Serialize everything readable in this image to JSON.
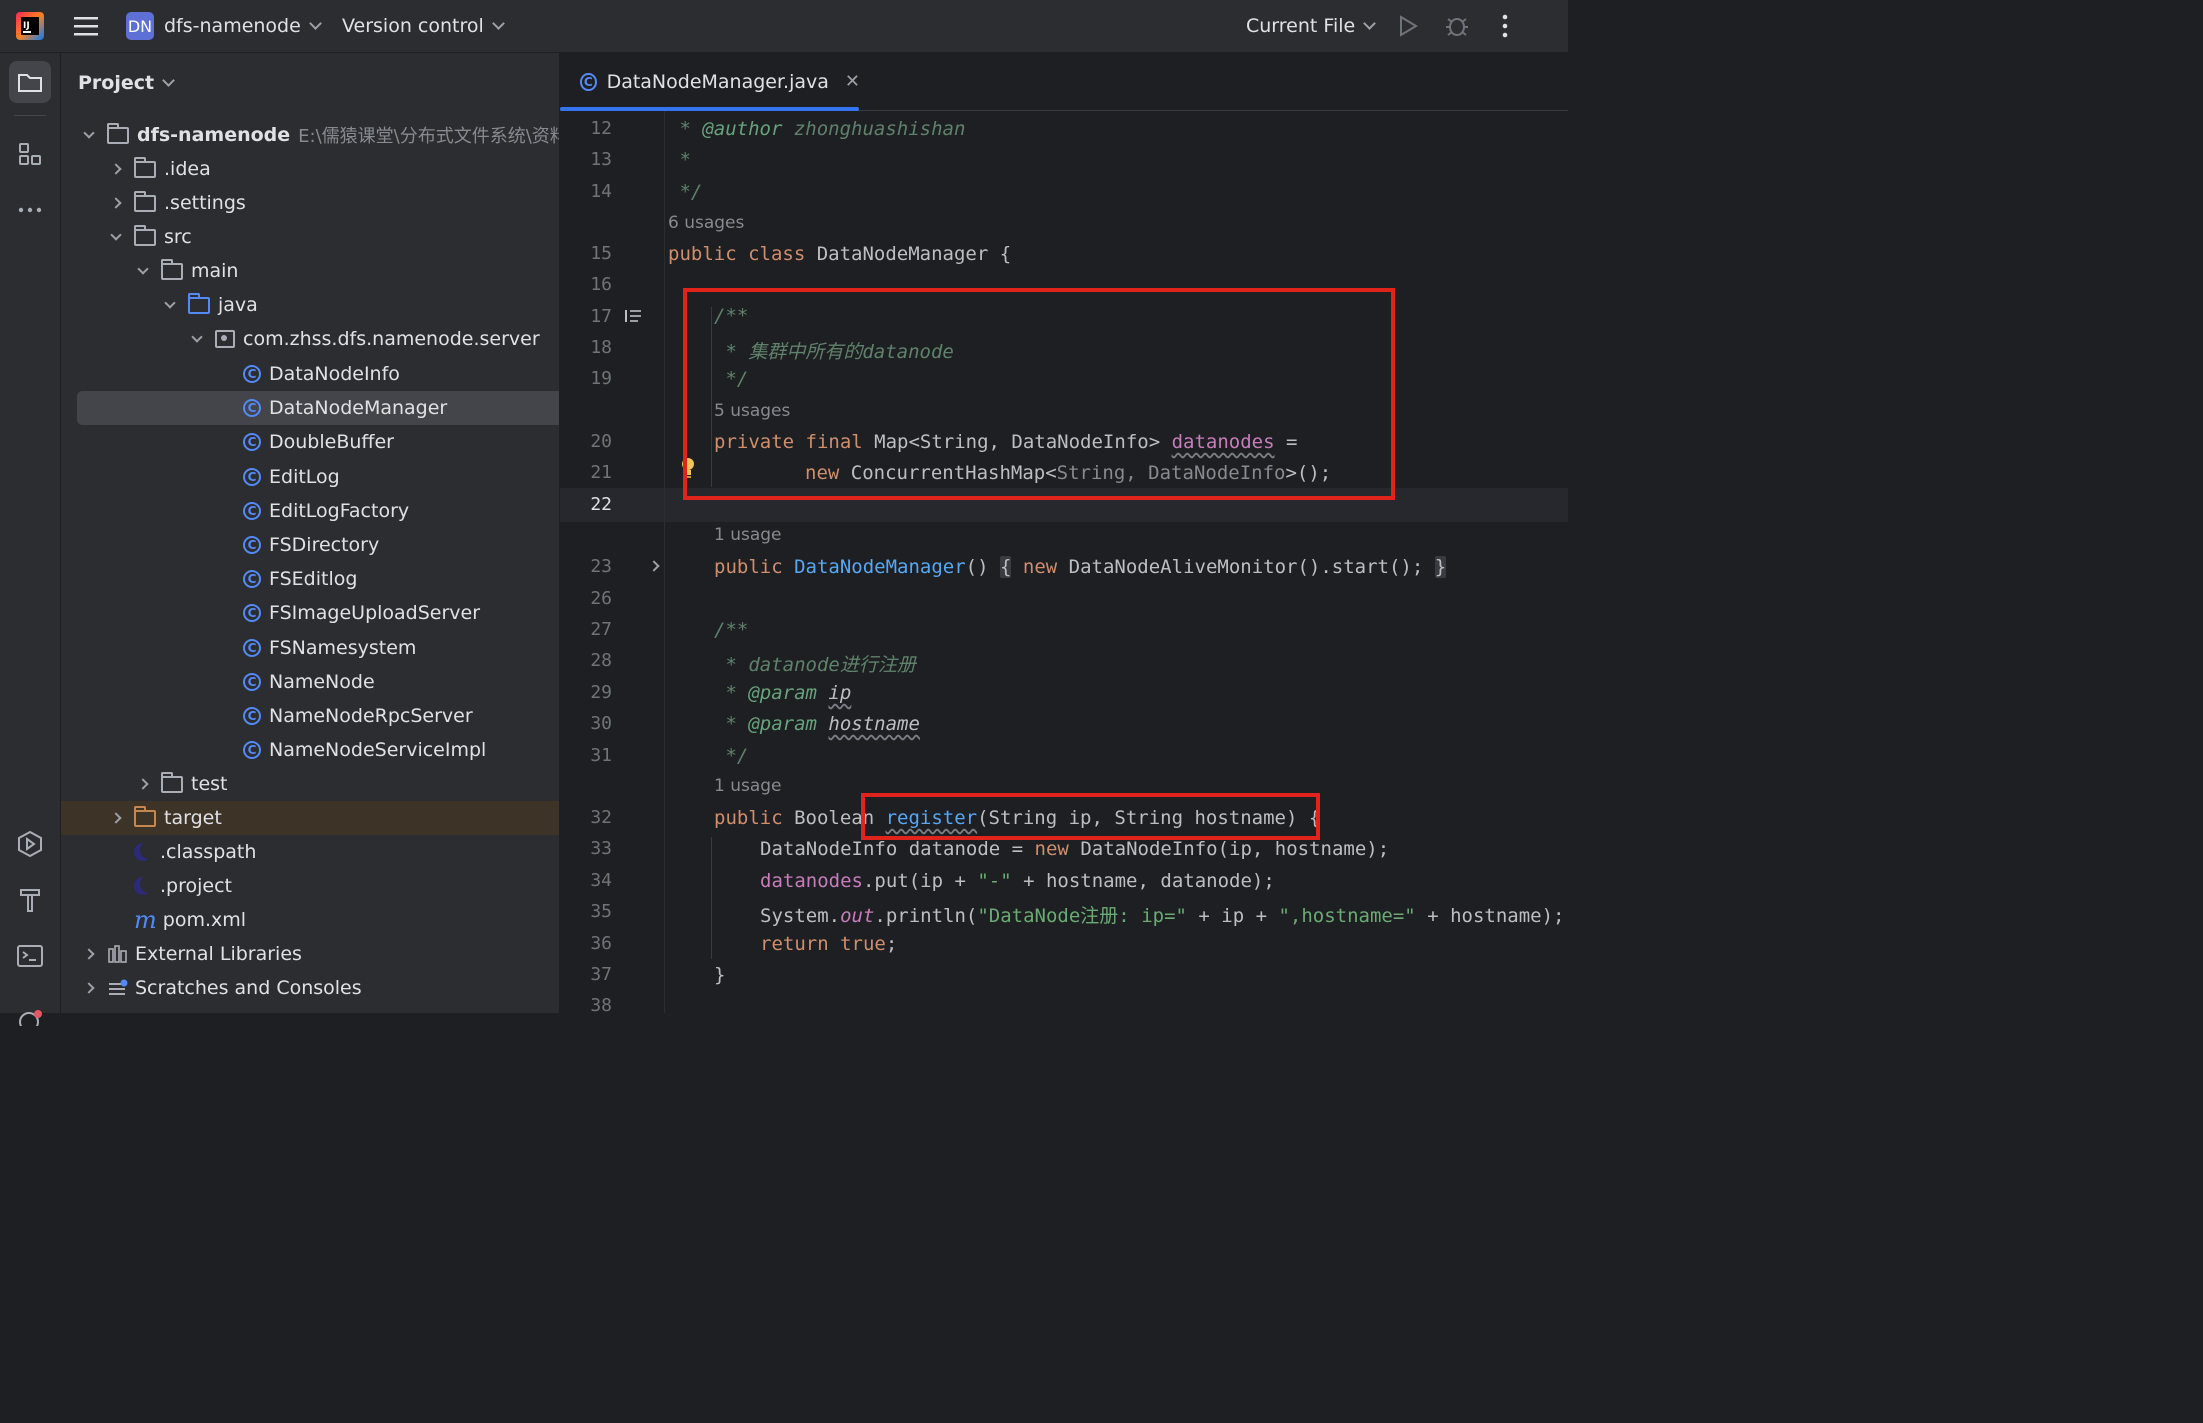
{
  "titlebar": {
    "app_logo": "intellij-logo",
    "project_badge": "DN",
    "project_name": "dfs-namenode",
    "vcs_label": "Version control",
    "run_config": "Current File"
  },
  "project_panel": {
    "title": "Project",
    "root_name": "dfs-namenode",
    "root_path": "E:\\儒猿课堂\\分布式文件系统\\资料",
    "items": {
      "idea": ".idea",
      "settings": ".settings",
      "src": "src",
      "main": "main",
      "java": "java",
      "package": "com.zhss.dfs.namenode.server",
      "classes": [
        "DataNodeInfo",
        "DataNodeManager",
        "DoubleBuffer",
        "EditLog",
        "EditLogFactory",
        "FSDirectory",
        "FSEditlog",
        "FSImageUploadServer",
        "FSNamesystem",
        "NameNode",
        "NameNodeRpcServer",
        "NameNodeServiceImpl"
      ],
      "test": "test",
      "target": "target",
      "classpath": ".classpath",
      "project_file": ".project",
      "pom": "pom.xml",
      "external_libraries": "External Libraries",
      "scratches": "Scratches and Consoles"
    }
  },
  "editor": {
    "tab_label": "DataNodeManager.java",
    "current_line": "22",
    "line_numbers": [
      "12",
      "13",
      "14",
      "15",
      "16",
      "17",
      "18",
      "19",
      "20",
      "21",
      "22",
      "23",
      "26",
      "27",
      "28",
      "29",
      "30",
      "31",
      "32",
      "33",
      "34",
      "35",
      "36",
      "37",
      "38"
    ],
    "usages": {
      "class": "6 usages",
      "field": "5 usages",
      "ctor": "1 usage",
      "register": "1 usage"
    },
    "code": {
      "author_star": " * ",
      "author_tag": "@author",
      "author_name": " zhonghuashishan",
      "star": " *",
      "end": " */",
      "class_kw": "public class",
      "class_name": " DataNodeManager {",
      "doc_open": "/**",
      "doc_cluster": " * 集群中所有的datanode",
      "doc_close": " */",
      "field_kw": "private final",
      "field_type": " Map<String, DataNodeInfo> ",
      "field_name": "datanodes",
      "field_eq": " =",
      "init_new": "new",
      "init_type": " ConcurrentHashMap<",
      "init_generic": "String, DataNodeInfo",
      "init_end": ">();",
      "ctor_kw": "public ",
      "ctor_name": "DataNodeManager",
      "ctor_parens": "()",
      "ctor_brace_open": "{",
      "ctor_new": " new",
      "ctor_body": " DataNodeAliveMonitor().start();",
      "ctor_brace_close": "}",
      "doc2_open": "/**",
      "doc2_register": " * datanode进行注册",
      "doc2_param_star": " * ",
      "param_tag": "@param",
      "param_ip": "ip",
      "param_hostname": "hostname",
      "doc2_close": " */",
      "reg_kw": "public",
      "reg_type": " Boolean ",
      "reg_name": "register",
      "reg_params": "(String ip, String hostname) {",
      "body1_a": "DataNodeInfo datanode = ",
      "body1_new": "new",
      "body1_b": " DataNodeInfo(ip, hostname);",
      "body2_field": "datanodes",
      "body2_a": ".put(ip + ",
      "body2_str": "\"-\"",
      "body2_b": " + hostname, datanode);",
      "body3_a": "System.",
      "body3_out": "out",
      "body3_b": ".println(",
      "body3_str1": "\"DataNode注册: ip=\"",
      "body3_c": " + ip + ",
      "body3_str2": "\",hostname=\"",
      "body3_d": " + hostname);",
      "ret_kw": "return",
      "ret_val": " true",
      "ret_end": ";",
      "close_brace": "}"
    }
  },
  "colors": {
    "accent": "#3574f0",
    "highlight_box": "#e0241b",
    "keyword": "#cf8e6d",
    "comment": "#5f826b",
    "field": "#c77dbb",
    "string": "#6aab73",
    "method": "#56a8f5"
  }
}
